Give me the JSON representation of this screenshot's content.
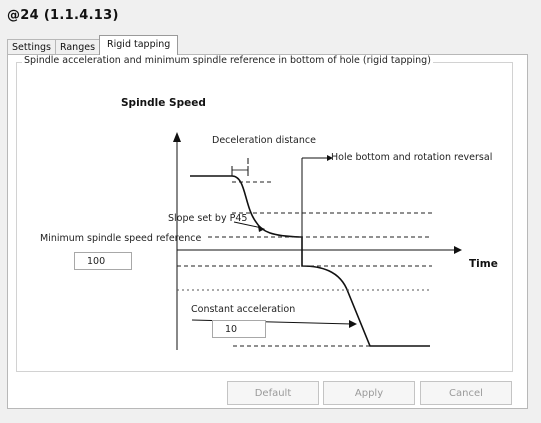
{
  "window": {
    "title": "@24  (1.1.4.13)"
  },
  "tabs": [
    {
      "label": "Settings",
      "active": false
    },
    {
      "label": "Ranges",
      "active": false
    },
    {
      "label": "Rigid tapping",
      "active": true
    }
  ],
  "group": {
    "label": "Spindle acceleration and minimum spindle reference in bottom of hole (rigid tapping)"
  },
  "diagram": {
    "y_axis_label": "Spindle Speed",
    "x_axis_label": "Time",
    "labels": {
      "deceleration_distance": "Deceleration distance",
      "hole_bottom": "Hole bottom and rotation reversal",
      "slope": "Slope set by P45",
      "min_speed_ref": "Minimum spindle speed reference",
      "constant_acceleration": "Constant acceleration"
    }
  },
  "fields": {
    "min_speed_ref_value": "100",
    "constant_acceleration_value": "10"
  },
  "buttons": {
    "default": "Default",
    "apply": "Apply",
    "cancel": "Cancel"
  },
  "colors": {
    "panel_bg": "#ffffff",
    "window_bg": "#f0f0f0",
    "disabled_text": "#9a9a9a"
  }
}
